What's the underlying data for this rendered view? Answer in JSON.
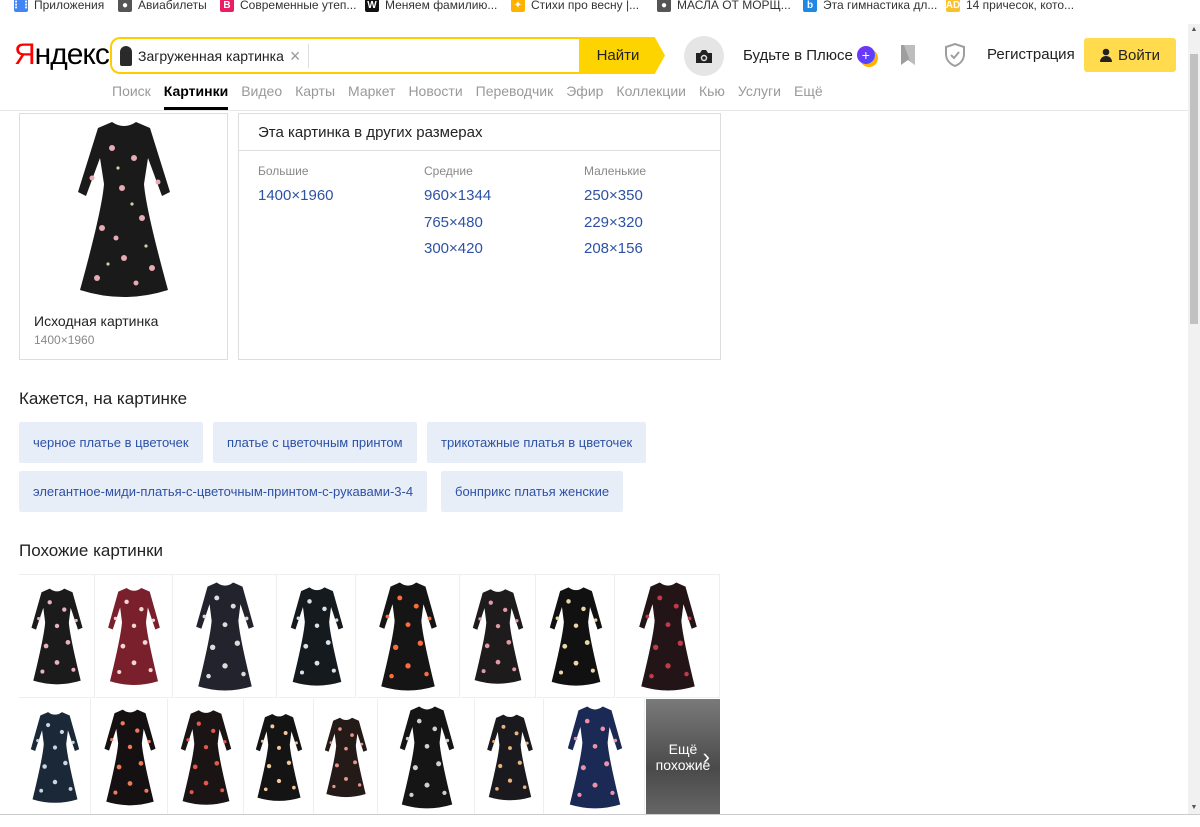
{
  "bookmarks": [
    {
      "label": "Приложения",
      "icon": "apps-grid-icon",
      "color": "#4285f4"
    },
    {
      "label": "Авиабилеты",
      "icon": "globe-icon",
      "color": "#555555"
    },
    {
      "label": "Современные утеп...",
      "icon": "b-logo-icon",
      "color": "#e91e63"
    },
    {
      "label": "Меняем фамилию...",
      "icon": "w-logo-icon",
      "color": "#111111"
    },
    {
      "label": "Стихи про весну |...",
      "icon": "pinwheel-icon",
      "color": "#ffb300"
    },
    {
      "label": "МАСЛА ОТ МОРЩ...",
      "icon": "globe-icon",
      "color": "#555555"
    },
    {
      "label": "Эта гимнастика дл...",
      "icon": "b-circle-icon",
      "color": "#1e88e5"
    },
    {
      "label": "14 причесок, кото...",
      "icon": "ad-logo-icon",
      "color": "#fbc02d"
    }
  ],
  "header": {
    "logo_first": "Я",
    "logo_rest": "ндекс",
    "search_chip_label": "Загруженная картинка",
    "search_placeholder": "",
    "find_button": "Найти",
    "plus_link": "Будьте в Плюсе",
    "plus_badge": "+",
    "register_link": "Регистрация",
    "login_button": "Войти"
  },
  "tabs": [
    {
      "label": "Поиск",
      "active": false
    },
    {
      "label": "Картинки",
      "active": true
    },
    {
      "label": "Видео",
      "active": false
    },
    {
      "label": "Карты",
      "active": false
    },
    {
      "label": "Маркет",
      "active": false
    },
    {
      "label": "Новости",
      "active": false
    },
    {
      "label": "Переводчик",
      "active": false
    },
    {
      "label": "Эфир",
      "active": false
    },
    {
      "label": "Коллекции",
      "active": false
    },
    {
      "label": "Кью",
      "active": false
    },
    {
      "label": "Услуги",
      "active": false
    },
    {
      "label": "Ещё",
      "active": false
    }
  ],
  "original": {
    "title": "Исходная картинка",
    "size": "1400×1960"
  },
  "sizes": {
    "title": "Эта картинка в других размерах",
    "columns": [
      {
        "title": "Большие",
        "items": [
          "1400×1960"
        ]
      },
      {
        "title": "Средние",
        "items": [
          "960×1344",
          "765×480",
          "300×420"
        ]
      },
      {
        "title": "Маленькие",
        "items": [
          "250×350",
          "229×320",
          "208×156"
        ]
      }
    ]
  },
  "tags_section": {
    "title": "Кажется, на картинке",
    "tags": [
      "черное платье в цветочек",
      "платье с цветочным принтом",
      "трикотажные платья в цветочек",
      "элегантное-миди-платья-с-цветочным-принтом-с-рукавами-3-4",
      "бонприкс платья женские"
    ]
  },
  "similar_section": {
    "title": "Похожие картинки",
    "row1": [
      {
        "bg": "#1b1b1b",
        "print": "#e8b4bc"
      },
      {
        "bg": "#7a1f2c",
        "print": "#f2d6d6"
      },
      {
        "bg": "#23232d",
        "print": "#dcdcdc"
      },
      {
        "bg": "#151a1f",
        "print": "#d9e2e8"
      },
      {
        "bg": "#151515",
        "print": "#ff6a3d"
      },
      {
        "bg": "#1e1b1c",
        "print": "#e39aa6"
      },
      {
        "bg": "#111111",
        "print": "#e9d7a6"
      },
      {
        "bg": "#231417",
        "print": "#c23a4a"
      }
    ],
    "row2": [
      {
        "bg": "#1a2838",
        "print": "#c7d6e4"
      },
      {
        "bg": "#151012",
        "print": "#ee7a5a"
      },
      {
        "bg": "#1a1415",
        "print": "#e2584a"
      },
      {
        "bg": "#141414",
        "print": "#f2c79a"
      },
      {
        "bg": "#241a18",
        "print": "#e8948a"
      },
      {
        "bg": "#151515",
        "print": "#d0d0d0"
      },
      {
        "bg": "#1a1a1e",
        "print": "#eab37c"
      },
      {
        "bg": "#1a2a55",
        "print": "#ef8fa8"
      }
    ],
    "more_line1": "Ещё",
    "more_line2": "похожие"
  },
  "colors": {
    "accent_yellow": "#ffdb4d",
    "link_blue": "#2d51a5",
    "tag_bg": "#e8eef8"
  }
}
